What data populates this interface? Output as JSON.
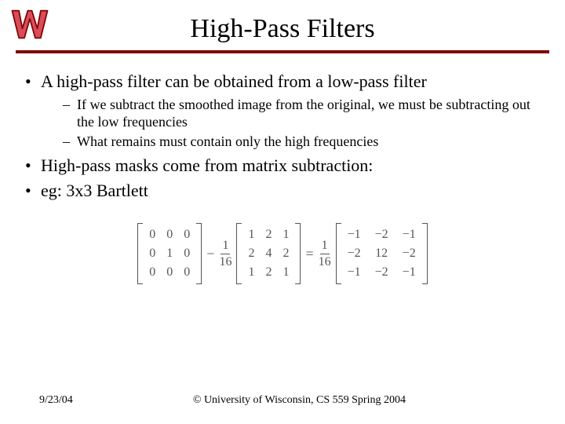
{
  "title": "High-Pass Filters",
  "bullets": {
    "b1": "A high-pass filter can be obtained from a low-pass filter",
    "b1s1": "If we subtract the smoothed image from the original, we must be subtracting out the low frequencies",
    "b1s2": "What remains must contain only the high frequencies",
    "b2": "High-pass masks come from matrix subtraction:",
    "b3": "eg: 3x3 Bartlett"
  },
  "eq": {
    "m1": {
      "r0": [
        "0",
        "0",
        "0"
      ],
      "r1": [
        "0",
        "1",
        "0"
      ],
      "r2": [
        "0",
        "0",
        "0"
      ]
    },
    "minus": "−",
    "frac1": {
      "num": "1",
      "den": "16"
    },
    "m2": {
      "r0": [
        "1",
        "2",
        "1"
      ],
      "r1": [
        "2",
        "4",
        "2"
      ],
      "r2": [
        "1",
        "2",
        "1"
      ]
    },
    "equals": "=",
    "frac2": {
      "num": "1",
      "den": "16"
    },
    "m3": {
      "r0": [
        "−1",
        "−2",
        "−1"
      ],
      "r1": [
        "−2",
        "12",
        "−2"
      ],
      "r2": [
        "−1",
        "−2",
        "−1"
      ]
    }
  },
  "footer": {
    "date": "9/23/04",
    "copyright": "© University of Wisconsin, CS 559 Spring 2004"
  }
}
